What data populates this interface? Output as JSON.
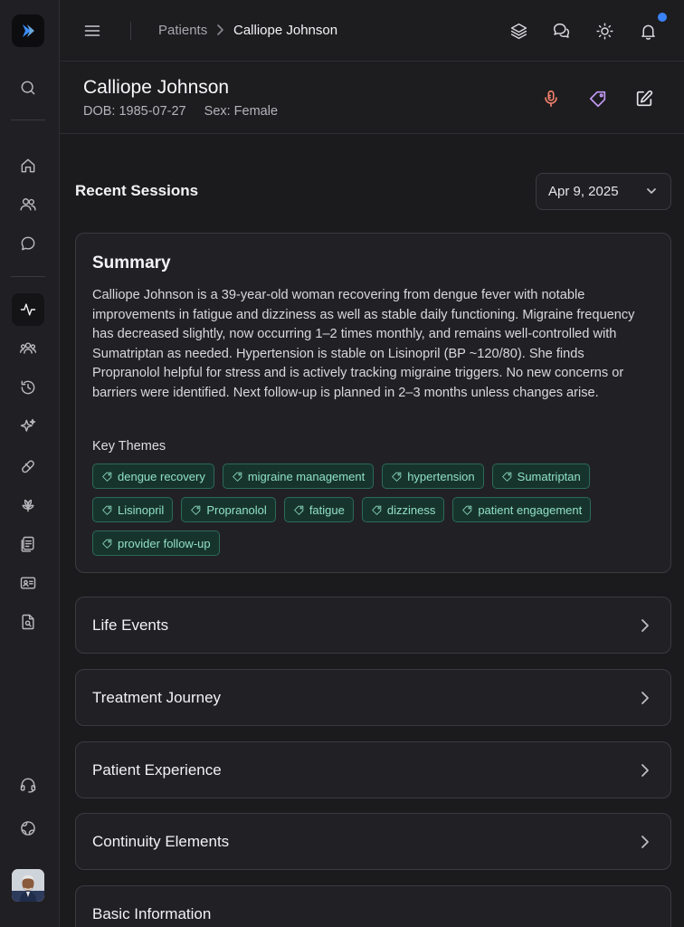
{
  "breadcrumb": {
    "parent": "Patients",
    "separator": ">",
    "current": "Calliope Johnson"
  },
  "patient": {
    "name": "Calliope Johnson",
    "dob_label": "DOB:",
    "dob": "1985-07-27",
    "sex_label": "Sex:",
    "sex": "Female"
  },
  "sessions": {
    "title": "Recent Sessions",
    "selected_date": "Apr 9, 2025"
  },
  "summary": {
    "title": "Summary",
    "text": "Calliope Johnson is a 39-year-old woman recovering from dengue fever with notable improvements in fatigue and dizziness as well as stable daily functioning. Migraine frequency has decreased slightly, now occurring 1–2 times monthly, and remains well-controlled with Sumatriptan as needed. Hypertension is stable on Lisinopril (BP ~120/80). She finds Propranolol helpful for stress and is actively tracking migraine triggers. No new concerns or barriers were identified. Next follow-up is planned in 2–3 months unless changes arise.",
    "themes_label": "Key Themes",
    "themes": [
      "dengue recovery",
      "migraine management",
      "hypertension",
      "Sumatriptan",
      "Lisinopril",
      "Propranolol",
      "fatigue",
      "dizziness",
      "patient engagement",
      "provider follow-up"
    ]
  },
  "sections": [
    {
      "title": "Life Events"
    },
    {
      "title": "Treatment Journey"
    },
    {
      "title": "Patient Experience"
    },
    {
      "title": "Continuity Elements"
    },
    {
      "title": "Basic Information"
    }
  ],
  "colors": {
    "accent_notification": "#3b82f6",
    "mic_icon": "#f0806a",
    "tag_icon": "#c59cf5",
    "tag_text": "#8fe0c4",
    "tag_bg": "#17342c"
  },
  "icons": {
    "sidebar": [
      "logo-icon",
      "search-icon",
      "home-icon",
      "users-icon",
      "chat-icon",
      "activity-icon",
      "group-icon",
      "history-icon",
      "sparkles-icon",
      "pill-icon",
      "lotus-icon",
      "documents-icon",
      "id-card-icon",
      "file-search-icon",
      "headset-icon",
      "globe-icon"
    ],
    "topbar": [
      "menu-icon",
      "layers-icon",
      "messages-icon",
      "sun-icon",
      "bell-icon"
    ],
    "header": [
      "microphone-icon",
      "tag-icon",
      "edit-icon"
    ]
  }
}
